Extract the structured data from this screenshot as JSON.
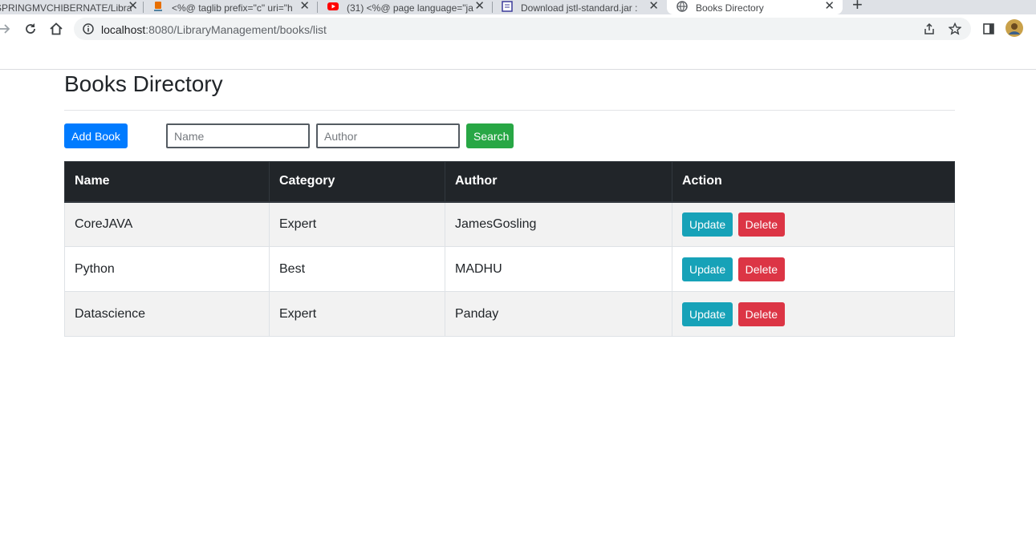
{
  "browser": {
    "tabs": [
      {
        "title": "SPRINGMVCHIBERNATE/Libra",
        "favicon": "github-icon",
        "active": false
      },
      {
        "title": "<%@ taglib prefix=\"c\" uri=\"h",
        "favicon": "java-icon",
        "active": false
      },
      {
        "title": "(31) <%@ page language=\"ja",
        "favicon": "youtube-icon",
        "active": false
      },
      {
        "title": "Download jstl-standard.jar :",
        "favicon": "document-icon",
        "active": false
      },
      {
        "title": "Books Directory",
        "favicon": "globe-icon",
        "active": true
      }
    ],
    "url_host": "localhost",
    "url_rest": ":8080/LibraryManagement/books/list"
  },
  "page": {
    "title": "Books Directory",
    "add_book_label": "Add Book",
    "name_placeholder": "Name",
    "author_placeholder": "Author",
    "search_label": "Search"
  },
  "table": {
    "headers": [
      "Name",
      "Category",
      "Author",
      "Action"
    ],
    "rows": [
      {
        "name": "CoreJAVA",
        "category": "Expert",
        "author": "JamesGosling",
        "update": "Update",
        "delete": "Delete"
      },
      {
        "name": "Python",
        "category": "Best",
        "author": "MADHU",
        "update": "Update",
        "delete": "Delete"
      },
      {
        "name": "Datascience",
        "category": "Expert",
        "author": "Panday",
        "update": "Update",
        "delete": "Delete"
      }
    ]
  },
  "colors": {
    "primary": "#007bff",
    "success": "#28a745",
    "info": "#17a2b8",
    "danger": "#dc3545",
    "table_header": "#212529"
  }
}
